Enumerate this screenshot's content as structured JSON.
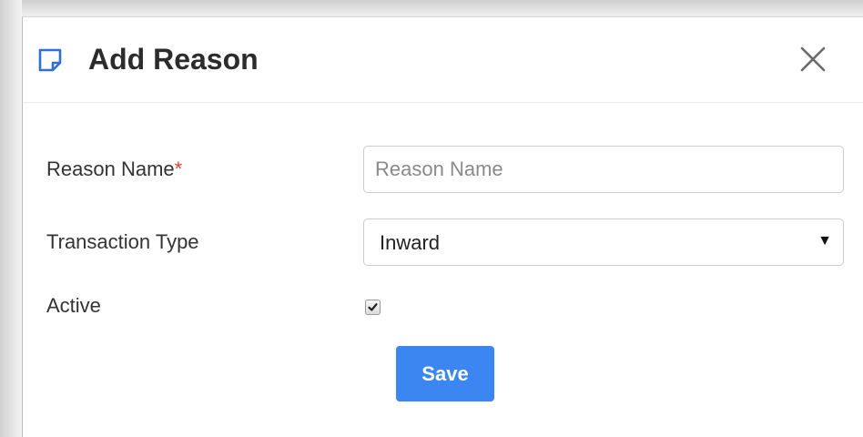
{
  "modal": {
    "title": "Add Reason",
    "title_icon": "note-icon",
    "close_icon": "close-icon"
  },
  "form": {
    "reason_name": {
      "label": "Reason Name",
      "required_mark": "*",
      "placeholder": "Reason Name",
      "value": ""
    },
    "transaction_type": {
      "label": "Transaction Type",
      "selected": "Inward",
      "arrow_icon": "caret-down-icon"
    },
    "active": {
      "label": "Active",
      "checked": true
    },
    "save_label": "Save"
  },
  "colors": {
    "accent": "#3b86f0",
    "required": "#e53935",
    "icon_blue": "#2f6fd6"
  }
}
